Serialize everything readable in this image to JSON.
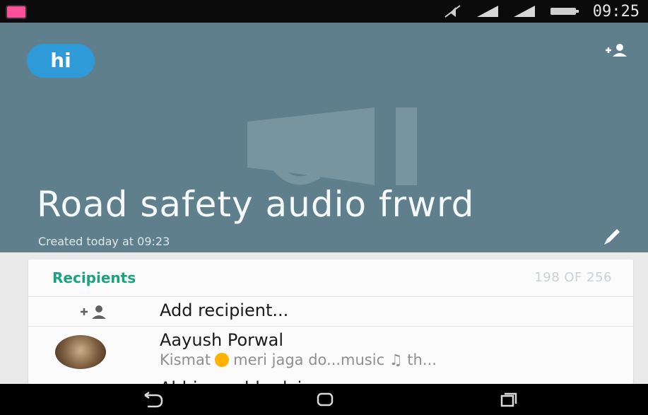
{
  "status_bar": {
    "time": "09:25"
  },
  "header": {
    "logo_text": "hi",
    "title": "Road safety audio frwrd",
    "created_text": "Created today at 09:23"
  },
  "recipients": {
    "label": "Recipients",
    "count": "198 OF 256",
    "add_label": "Add recipient...",
    "contact": {
      "name": "Aayush Porwal",
      "message_pre": "Kismat",
      "message_post": "meri jaga do...music ♫ th..."
    },
    "next_contact_partial": "Abhinav abhedyi"
  },
  "nav": {
    "back": "back-icon",
    "home": "home-icon",
    "recents": "recents-icon"
  }
}
